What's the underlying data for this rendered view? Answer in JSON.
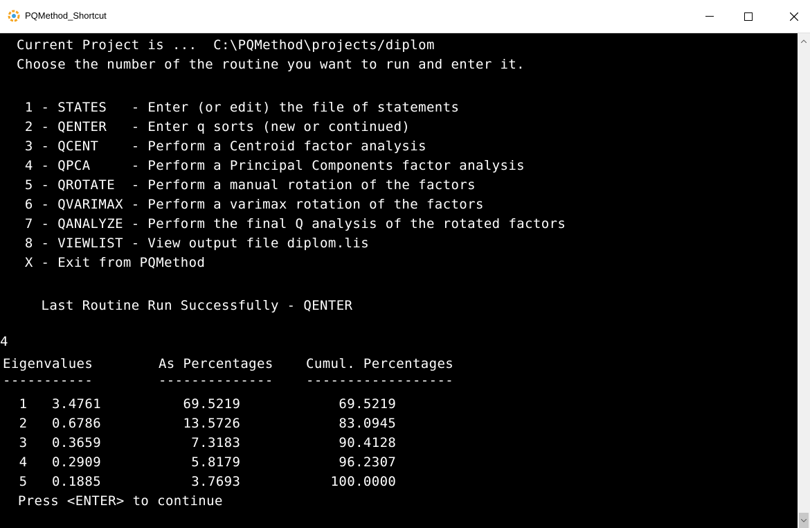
{
  "window": {
    "title": "PQMethod_Shortcut"
  },
  "console": {
    "lines": [
      "Current Project is ...  C:\\PQMethod\\projects/diplom",
      "Choose the number of the routine you want to run and enter it.",
      "",
      " 1 - STATES   - Enter (or edit) the file of statements",
      " 2 - QENTER   - Enter q sorts (new or continued)",
      " 3 - QCENT    - Perform a Centroid factor analysis",
      " 4 - QPCA     - Perform a Principal Components factor analysis",
      " 5 - QROTATE  - Perform a manual rotation of the factors",
      " 6 - QVARIMAX - Perform a varimax rotation of the factors",
      " 7 - QANALYZE - Perform the final Q analysis of the rotated factors",
      " 8 - VIEWLIST - View output file diplom.lis",
      " X - Exit from PQMethod",
      "",
      "   Last Routine Run Successfully - QENTER",
      "",
      "4",
      "Eigenvalues        As Percentages    Cumul. Percentages",
      "-----------        --------------    ------------------",
      "  1   3.4761          69.5219            69.5219",
      "  2   0.6786          13.5726            83.0945",
      "  3   0.3659           7.3183            90.4128",
      "  4   0.2909           5.8179            96.2307",
      "  5   0.1885           3.7693           100.0000",
      " Press <ENTER> to continue"
    ]
  },
  "colors": {
    "console_bg": "#000000",
    "console_fg": "#ffffff",
    "titlebar_bg": "#ffffff"
  }
}
